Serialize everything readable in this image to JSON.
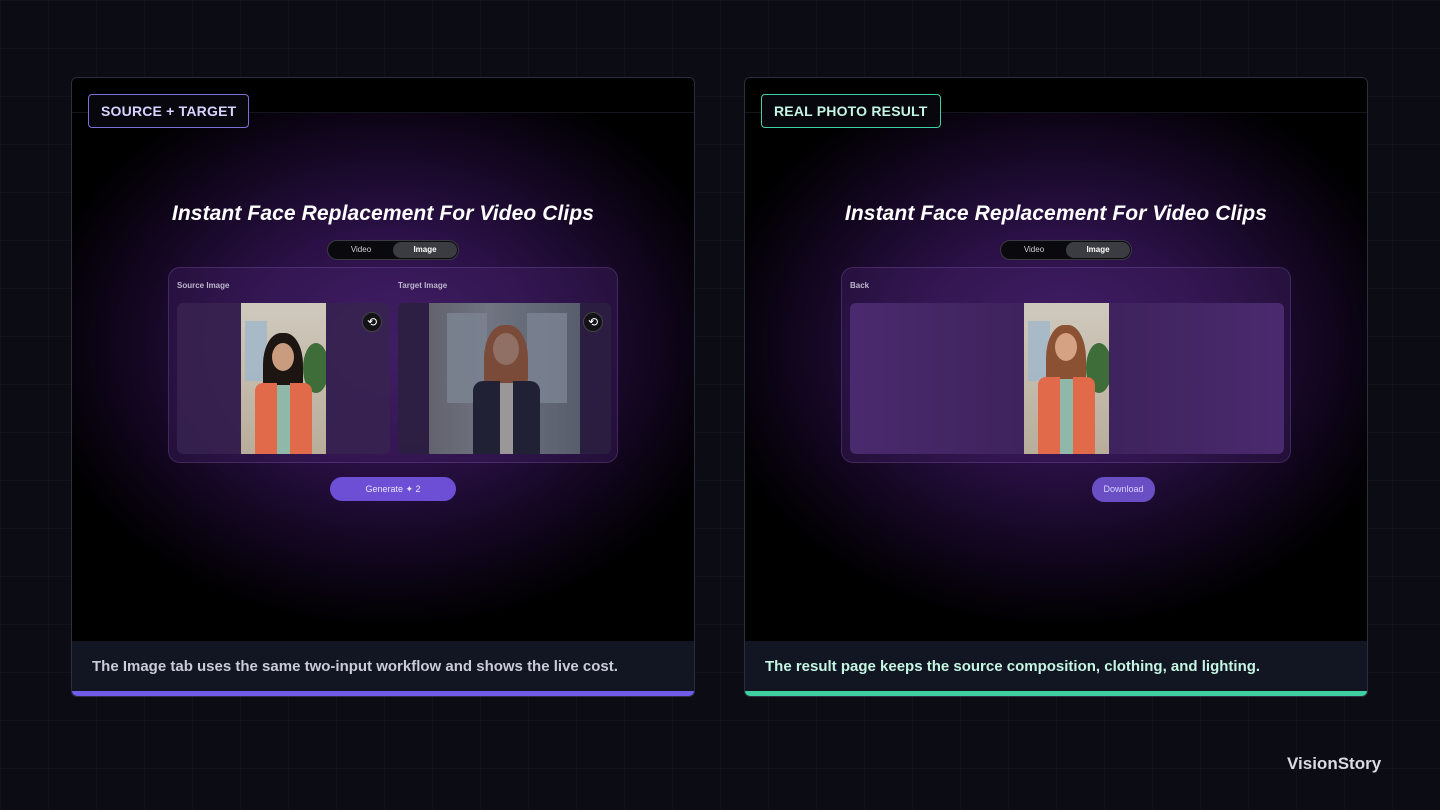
{
  "colors": {
    "violet_accent": "#6f5ce8",
    "teal_accent": "#3fd0a2",
    "page_bg": "#0c0d14"
  },
  "left_card": {
    "pill": "SOURCE + TARGET",
    "title": "Instant Face Replacement For Video Clips",
    "tabs": [
      {
        "label": "Video",
        "active": false
      },
      {
        "label": "Image",
        "active": true
      }
    ],
    "source_label": "Source Image",
    "target_label": "Target Image",
    "swap_icon": "swap-icon",
    "generate_label": "Generate ✦ 2",
    "caption": "The Image tab uses the same two-input workflow and shows the live cost."
  },
  "right_card": {
    "pill": "REAL PHOTO RESULT",
    "title": "Instant Face Replacement For Video Clips",
    "tabs": [
      {
        "label": "Video",
        "active": false
      },
      {
        "label": "Image",
        "active": true
      }
    ],
    "back_label": "Back",
    "download_label": "Download",
    "caption": "The result page keeps the source composition, clothing, and lighting."
  },
  "brand": "VisionStory"
}
